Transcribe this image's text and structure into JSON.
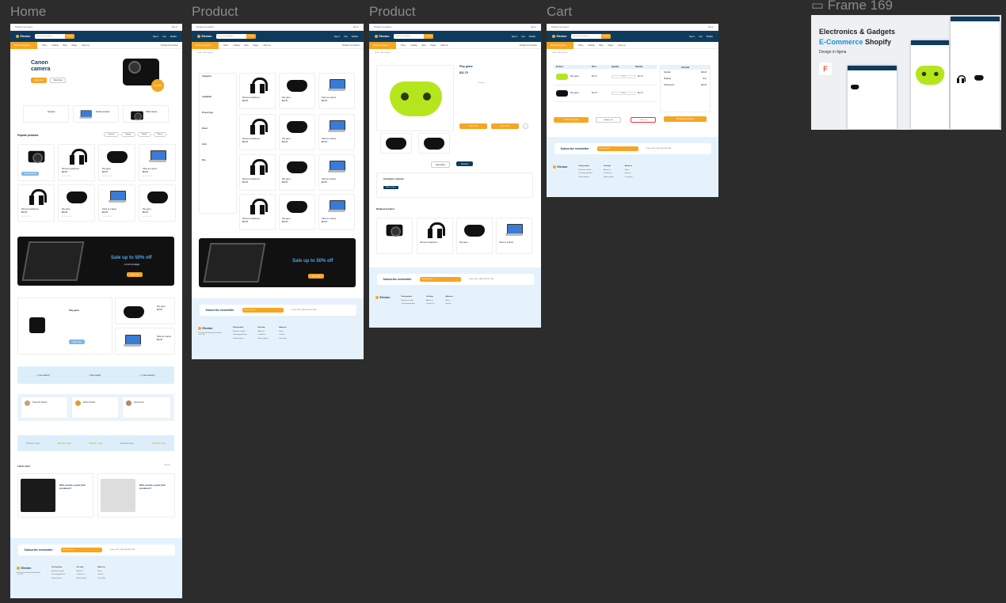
{
  "labels": {
    "home": "Home",
    "product1": "Product",
    "product2": "Product",
    "cart": "Cart",
    "frame": "Frame 169"
  },
  "colors": {
    "canvas": "#2c2c2c",
    "navy": "#0e3b5c",
    "accent": "#f5a623",
    "lightblue": "#e6f2fb",
    "lime": "#b5e61d"
  },
  "store": {
    "logo": "Electon",
    "search_placeholder": "Search for anything",
    "search_button": "Search",
    "icons": [
      "Sign in",
      "Cart",
      "Wishlist"
    ],
    "categories": "Browse categories",
    "nav": [
      "Home",
      "Catalog",
      "Blog",
      "Pages",
      "About us"
    ],
    "free_shipping": "30 Days Free Return"
  },
  "home": {
    "hero_title": "Canon camera",
    "hero_buttons": [
      "Shop now",
      "View more"
    ],
    "hero_badge": "Only $89",
    "features": [
      "Speakers",
      "Desktop & laptop",
      "DSLR camera"
    ],
    "popular": "Popular products",
    "filters": [
      "Cameras",
      "Laptops",
      "Tablets",
      "Mouse"
    ],
    "products": [
      {
        "name": "Canon Camera",
        "price": "$11.70"
      },
      {
        "name": "Wireless headphones",
        "price": "$11.70"
      },
      {
        "name": "Play game",
        "price": "$11.70"
      },
      {
        "name": "Tablet as a laptop",
        "price": "$11.70"
      },
      {
        "name": "Wireless headphones",
        "price": "$11.70"
      },
      {
        "name": "Play game",
        "price": "$11.70"
      },
      {
        "name": "Tablet as a laptop",
        "price": "$11.70"
      },
      {
        "name": "Play game",
        "price": "$11.70"
      }
    ],
    "sale": "Sale up to 50% off",
    "sale_sub": "12 inch hd display",
    "sale_button": "Shop now",
    "benefits": [
      "Free delivery",
      "Best quality",
      "1 year warranty"
    ],
    "testimonials": [
      "Savannah Nguyen",
      "Esther Howard",
      "Jacob Jones"
    ],
    "brands": [
      "Brand Logo",
      "Brand Logo",
      "Brand Logo",
      "Brand Logo",
      "Brand Logo"
    ],
    "latest_news": "Latest news",
    "view_all": "View all",
    "news": [
      "Who avoids a pain that produces?",
      "Who avoids a pain that produces?"
    ]
  },
  "newsletter": {
    "title": "Subscribe newsletter",
    "input": "Email address",
    "call": "Call us 24/7 (+62) 0123 567 789"
  },
  "footer": {
    "about": "64 st james boulevard hoswick , ze2 7zj",
    "cols": [
      {
        "h": "Find product",
        "items": [
          "Brownze arnold",
          "Chronograph blue",
          "Smart phones",
          "Automatic watch",
          "Hair straighteners"
        ]
      },
      {
        "h": "Get help",
        "items": [
          "About us",
          "Contact us",
          "Return policy",
          "Privacy policy",
          "Payment policy"
        ]
      },
      {
        "h": "About us",
        "items": [
          "News",
          "Service",
          "Our policy",
          "Custmer care",
          "Faq's"
        ]
      }
    ]
  },
  "product_list": {
    "crumb": "Home > All category",
    "sidebar_heads": [
      "Categories",
      "Availability",
      "Product type",
      "Brand",
      "Color",
      "Size"
    ],
    "sale": "Sale up to 50% off"
  },
  "product_detail": {
    "title": "Play game",
    "price": "$11.70",
    "stock": "In stock",
    "buttons": [
      "Add to cart",
      "Buy it now"
    ],
    "tabs": [
      "Description",
      "Reviews"
    ],
    "reviews": "Customer reviews",
    "write_review": "Write a review",
    "related": "Related product"
  },
  "cart": {
    "cols": [
      "Product",
      "Price",
      "Quantity",
      "Subtotal"
    ],
    "items": [
      {
        "name": "Play game",
        "price": "$11.70",
        "sub": "$11.70"
      },
      {
        "name": "Play game",
        "price": "$11.70",
        "sub": "$11.70"
      }
    ],
    "buttons": [
      "Continue shopping",
      "Update cart",
      "Clear cart"
    ],
    "summary_title": "Cart total",
    "summary": [
      {
        "k": "Subtotal",
        "v": "$23.20"
      },
      {
        "k": "Shipping",
        "v": "Free"
      },
      {
        "k": "Total amount",
        "v": "$23.20"
      }
    ],
    "checkout": "Proceed to checkout"
  },
  "cover": {
    "line1": "Electronics & Gadgets",
    "line2a": "E-Commerce",
    "line2b": "Shopify",
    "line3": "Design in figma"
  }
}
